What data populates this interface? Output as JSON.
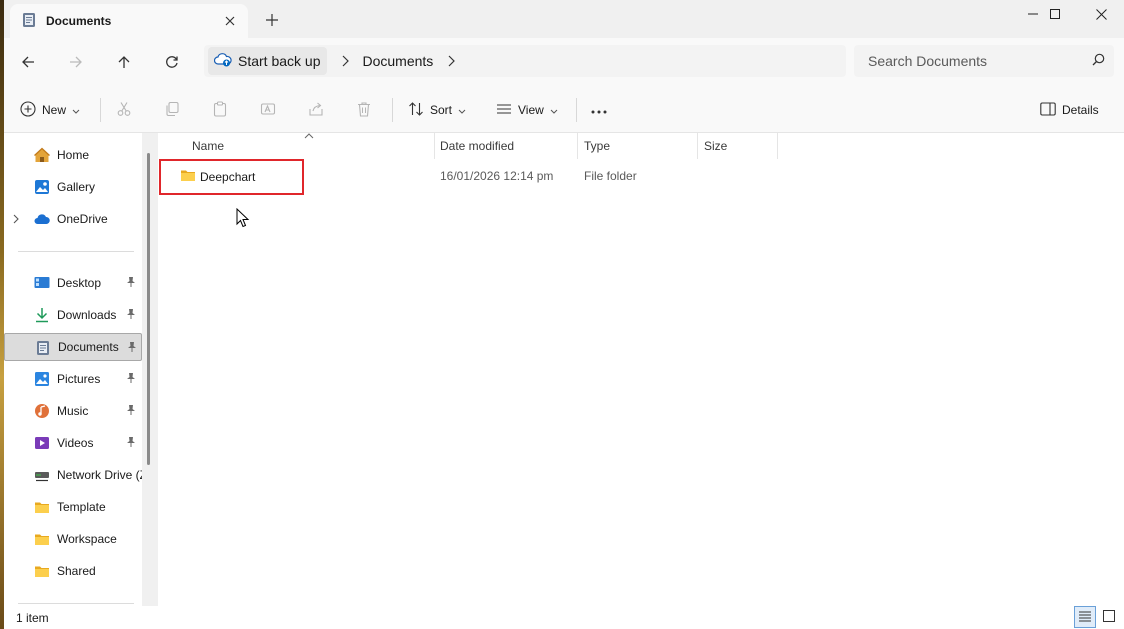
{
  "window": {
    "tab_title": "Documents",
    "accent": "#0067c0"
  },
  "address": {
    "root_label": "Start back up",
    "crumbs": [
      "Documents"
    ],
    "search_placeholder": "Search Documents"
  },
  "toolbar": {
    "new_label": "New",
    "sort_label": "Sort",
    "view_label": "View",
    "more_label": "···",
    "details_label": "Details"
  },
  "sidebar": {
    "quick": [
      {
        "label": "Home",
        "icon": "home-icon"
      },
      {
        "label": "Gallery",
        "icon": "gallery-icon"
      },
      {
        "label": "OneDrive",
        "icon": "cloud-icon"
      }
    ],
    "pinned": [
      {
        "label": "Desktop",
        "icon": "desktop-icon",
        "pinned": true
      },
      {
        "label": "Downloads",
        "icon": "download-icon",
        "pinned": true
      },
      {
        "label": "Documents",
        "icon": "documents-icon",
        "pinned": true,
        "selected": true
      },
      {
        "label": "Pictures",
        "icon": "pictures-icon",
        "pinned": true
      },
      {
        "label": "Music",
        "icon": "music-icon",
        "pinned": true
      },
      {
        "label": "Videos",
        "icon": "videos-icon",
        "pinned": true
      },
      {
        "label": "Network Drive (Z:)",
        "icon": "network-drive-icon",
        "pinned": false
      },
      {
        "label": "Template",
        "icon": "folder-icon",
        "pinned": false
      },
      {
        "label": "Workspace",
        "icon": "folder-icon",
        "pinned": false
      },
      {
        "label": "Shared",
        "icon": "folder-icon",
        "pinned": false
      }
    ]
  },
  "columns": {
    "name": "Name",
    "date": "Date modified",
    "type": "Type",
    "size": "Size"
  },
  "files": [
    {
      "name": "Deepchart",
      "date": "16/01/2026 12:14 pm",
      "type": "File folder",
      "size": ""
    }
  ],
  "status": {
    "count": "1 item"
  }
}
